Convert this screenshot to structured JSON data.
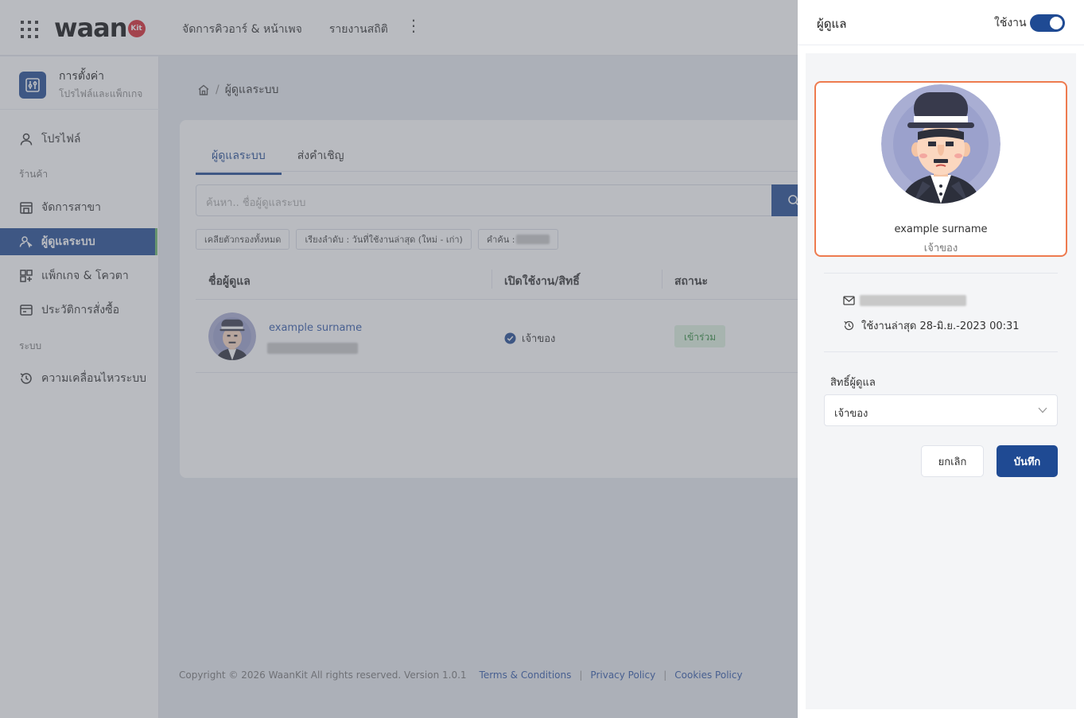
{
  "app": {
    "logo_text": "waan",
    "logo_badge": "Kit",
    "nav": [
      "จัดการคิวอาร์ & หน้าเพจ",
      "รายงานสถิติ"
    ],
    "more_glyph": "⋮"
  },
  "sidebar": {
    "title": "การตั้งค่า",
    "subtitle": "โปรไฟล์และแพ็กเกจ",
    "items": [
      {
        "label": "โปรไฟล์",
        "icon": "user-icon"
      },
      {
        "label": "จัดการสาขา",
        "icon": "store-icon"
      },
      {
        "label": "ผู้ดูแลระบบ",
        "icon": "admin-users-icon",
        "active": true
      },
      {
        "label": "แพ็กเกจ & โควตา",
        "icon": "package-icon"
      },
      {
        "label": "ประวัติการสั่งซื้อ",
        "icon": "wallet-icon"
      },
      {
        "label": "ความเคลื่อนไหวระบบ",
        "icon": "history-icon"
      }
    ],
    "groups": [
      "ร้านค้า",
      "ระบบ"
    ]
  },
  "breadcrumb": {
    "home_icon": "home-icon",
    "separator": "/",
    "current": "ผู้ดูแลระบบ"
  },
  "main": {
    "tabs": [
      {
        "label": "ผู้ดูแลระบบ",
        "active": true
      },
      {
        "label": "ส่งคำเชิญ"
      }
    ],
    "search_placeholder": "ค้นหา.. ชื่อผู้ดูแลระบบ",
    "chips": [
      "เคลียตัวกรองทั้งหมด",
      "เรียงลำดับ : วันที่ใช้งานล่าสุด (ใหม่ - เก่า)",
      "คำค้น :"
    ],
    "columns": [
      "ชื่อผู้ดูแล",
      "เปิดใช้งาน/สิทธิ์",
      "สถานะ"
    ],
    "row": {
      "name": "example surname",
      "role": "เจ้าของ",
      "status": "เข้าร่วม"
    }
  },
  "footer": {
    "copyright": "Copyright © 2026 WaanKit All rights reserved. Version 1.0.1",
    "links": [
      "Terms & Conditions",
      "Privacy Policy",
      "Cookies Policy"
    ],
    "separator": "|"
  },
  "drawer": {
    "title": "ผู้ดูแล",
    "toggle_label": "ใช้งาน",
    "toggle_on": true,
    "profile_name": "example surname",
    "profile_role": "เจ้าของ",
    "last_used": "ใช้งานล่าสุด 28-มิ.ย.-2023 00:31",
    "permission_label": "สิทธิ์ผู้ดูแล",
    "permission_value": "เจ้าของ",
    "cancel_label": "ยกเลิก",
    "save_label": "บันทึก"
  },
  "colors": {
    "primary": "#1f4a93",
    "highlight_border": "#ee7b4f",
    "status_bg": "#dff3e1",
    "status_text": "#2f8a3c"
  }
}
